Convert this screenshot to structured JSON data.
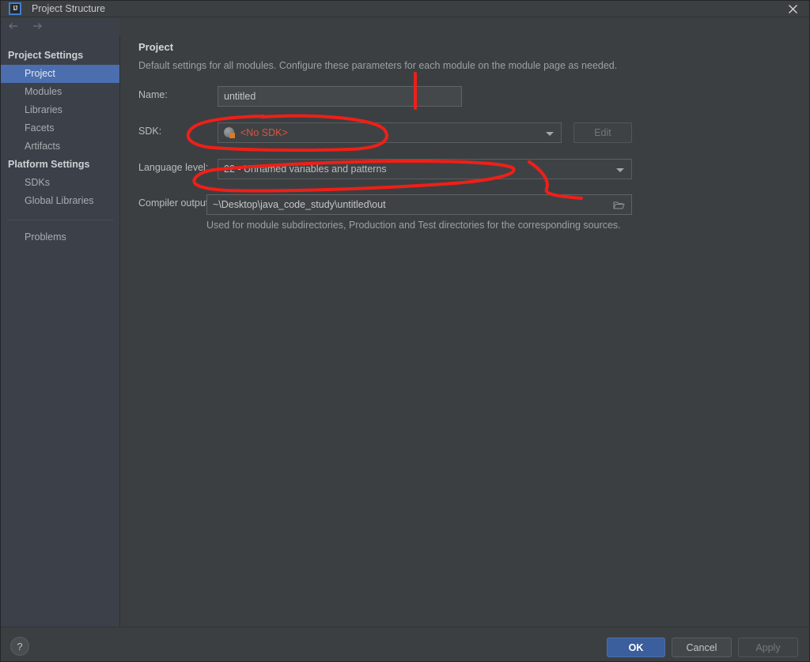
{
  "window": {
    "title": "Project Structure",
    "logo_text": "IJ",
    "close_icon": "close-icon"
  },
  "toolbar": {
    "back_icon": "arrow-left-icon",
    "forward_icon": "arrow-right-icon"
  },
  "sidebar": {
    "groups": [
      {
        "label": "Project Settings",
        "items": [
          {
            "label": "Project",
            "selected": true
          },
          {
            "label": "Modules",
            "selected": false
          },
          {
            "label": "Libraries",
            "selected": false
          },
          {
            "label": "Facets",
            "selected": false
          },
          {
            "label": "Artifacts",
            "selected": false
          }
        ]
      },
      {
        "label": "Platform Settings",
        "items": [
          {
            "label": "SDKs",
            "selected": false
          },
          {
            "label": "Global Libraries",
            "selected": false
          }
        ]
      }
    ],
    "problems_label": "Problems"
  },
  "main": {
    "title": "Project",
    "description": "Default settings for all modules. Configure these parameters for each module on the module page as needed.",
    "fields": {
      "name": {
        "label": "Name:",
        "value": "untitled"
      },
      "sdk": {
        "label": "SDK:",
        "value": "<No SDK>",
        "value_color": "#d9553f",
        "icon": "sdk-globe-icon",
        "edit_button": "Edit",
        "edit_disabled": true
      },
      "language_level": {
        "label": "Language level:",
        "value": "22 - Unnamed variables and patterns"
      },
      "compiler_output": {
        "label": "Compiler output:",
        "value": "~\\Desktop\\java_code_study\\untitled\\out",
        "browse_icon": "folder-icon",
        "helper_text": "Used for module subdirectories, Production and Test directories for the corresponding sources."
      }
    }
  },
  "footer": {
    "help_label": "?",
    "ok_label": "OK",
    "cancel_label": "Cancel",
    "apply_label": "Apply",
    "apply_disabled": true
  },
  "annotations": {
    "color": "#f01f18",
    "marks": [
      "vertical-line-over-name-field",
      "ellipse-around-sdk-combo",
      "ellipse-around-language-level-combo",
      "hook-stroke-right-of-language-level"
    ]
  },
  "colors": {
    "dialog_background": "#3c3f41",
    "sidebar_background": "#3c4049",
    "selection_blue": "#4b6eaf",
    "primary_button": "#3b5e9c",
    "annotation_red": "#f01f18",
    "sdk_warning": "#d9553f"
  }
}
